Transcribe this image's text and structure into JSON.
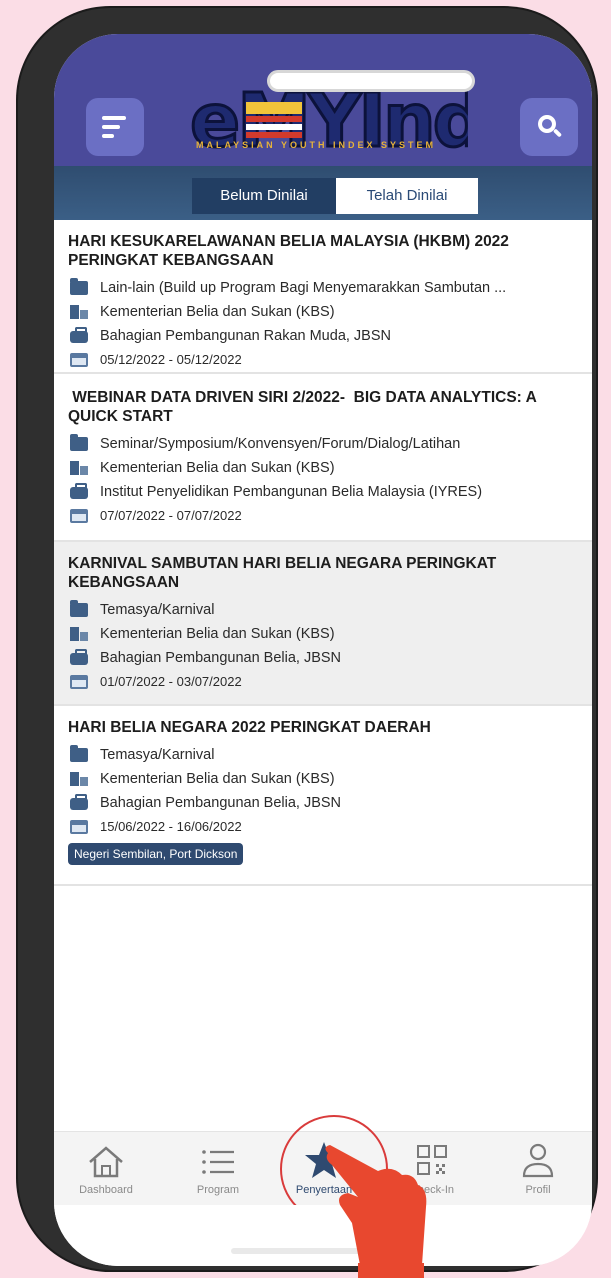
{
  "header": {
    "logo_text": "eMYInd",
    "logo_subtitle": "MALAYSIAN YOUTH INDEX SYSTEM"
  },
  "tabs": [
    {
      "label": "Belum Dinilai",
      "selected": false
    },
    {
      "label": "Telah Dinilai",
      "selected": true
    }
  ],
  "programs": [
    {
      "title": "HARI KESUKARELAWANAN BELIA MALAYSIA (HKBM) 2022 PERINGKAT KEBANGSAAN",
      "title_lines": [
        "HARI KESUKARELAWANAN BELIA MALAYSIA (HKBM) 2022",
        "PERINGKAT KEBANGSAAN"
      ],
      "category": "Lain-lain (Build up Program Bagi Menyemarakkan Sambutan ...",
      "ministry": "Kementerian Belia dan Sukan (KBS)",
      "division": "Bahagian Pembangunan Rakan Muda, JBSN",
      "date": "05/12/2022 - 05/12/2022"
    },
    {
      "title": "WEBINAR DATA DRIVEN SIRI 2/2022- BIG DATA ANALYTICS: A QUICK START",
      "title_lines": [
        " WEBINAR DATA DRIVEN SIRI 2/2022-  BIG DATA ANALYTICS: A",
        "QUICK START"
      ],
      "category": "Seminar/Symposium/Konvensyen/Forum/Dialog/Latihan",
      "ministry": "Kementerian Belia dan Sukan (KBS)",
      "division": "Institut Penyelidikan Pembangunan Belia Malaysia (IYRES)",
      "date": "07/07/2022 - 07/07/2022"
    },
    {
      "title": "KARNIVAL SAMBUTAN HARI BELIA NEGARA PERINGKAT KEBANGSAAN",
      "title_lines": [
        "KARNIVAL SAMBUTAN HARI BELIA NEGARA PERINGKAT",
        "KEBANGSAAN"
      ],
      "category": "Temasya/Karnival",
      "ministry": "Kementerian Belia dan Sukan (KBS)",
      "division": "Bahagian Pembangunan Belia, JBSN",
      "date": "01/07/2022 - 03/07/2022"
    },
    {
      "title": "HARI BELIA NEGARA 2022 PERINGKAT DAERAH",
      "title_lines": [
        "HARI BELIA NEGARA 2022 PERINGKAT DAERAH"
      ],
      "category": "Temasya/Karnival",
      "ministry": "Kementerian Belia dan Sukan (KBS)",
      "division": "Bahagian Pembangunan Belia, JBSN",
      "date": "15/06/2022 - 16/06/2022",
      "location": "Negeri Sembilan, Port Dickson"
    }
  ],
  "bottom_nav": [
    {
      "label": "Dashboard",
      "icon": "home-icon"
    },
    {
      "label": "Program",
      "icon": "list-icon"
    },
    {
      "label": "Penyertaan",
      "icon": "star-icon",
      "active": true
    },
    {
      "label": "Check-In",
      "icon": "qr-code-icon"
    },
    {
      "label": "Profil",
      "icon": "user-icon"
    }
  ],
  "colors": {
    "header": "#4a4a9a",
    "tab_bar": "#2f4d70",
    "accent": "#2f4a70",
    "highlight_circle": "#d93b3b",
    "pointer_hand": "#e8482f",
    "background": "#fbdde6"
  }
}
